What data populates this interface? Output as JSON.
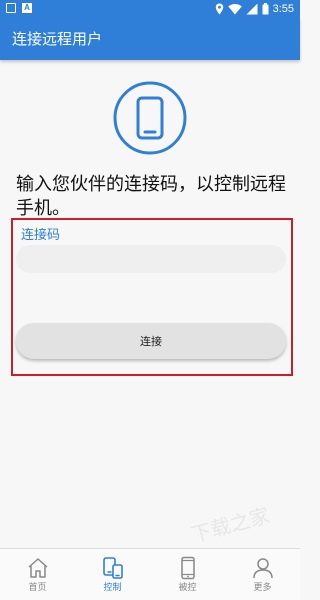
{
  "status_bar": {
    "time": "3:55",
    "left_icons": [
      "keyboard-icon",
      "a-notification-icon"
    ],
    "right_icons": [
      "location-icon",
      "wifi-icon",
      "signal-icon",
      "battery-icon"
    ]
  },
  "header": {
    "title": "连接远程用户"
  },
  "main": {
    "hero_icon": "phone-icon",
    "headline": "输入您伙伴的连接码，以控制远程手机。",
    "connect_panel": {
      "code_label": "连接码",
      "code_value": "",
      "code_placeholder": "",
      "connect_button_label": "连接"
    }
  },
  "watermark_text": "下载之家",
  "bottom_nav": {
    "items": [
      {
        "label": "首页",
        "icon": "home-icon",
        "active": false
      },
      {
        "label": "控制",
        "icon": "devices-icon",
        "active": true
      },
      {
        "label": "被控",
        "icon": "phone-icon",
        "active": false
      },
      {
        "label": "更多",
        "icon": "person-icon",
        "active": false
      }
    ]
  },
  "colors": {
    "primary": "#2f7fd8",
    "highlight_border": "#c8202a",
    "background": "#f7f7f7",
    "button_background": "#e2e2e2",
    "inactive_nav": "#888888"
  }
}
